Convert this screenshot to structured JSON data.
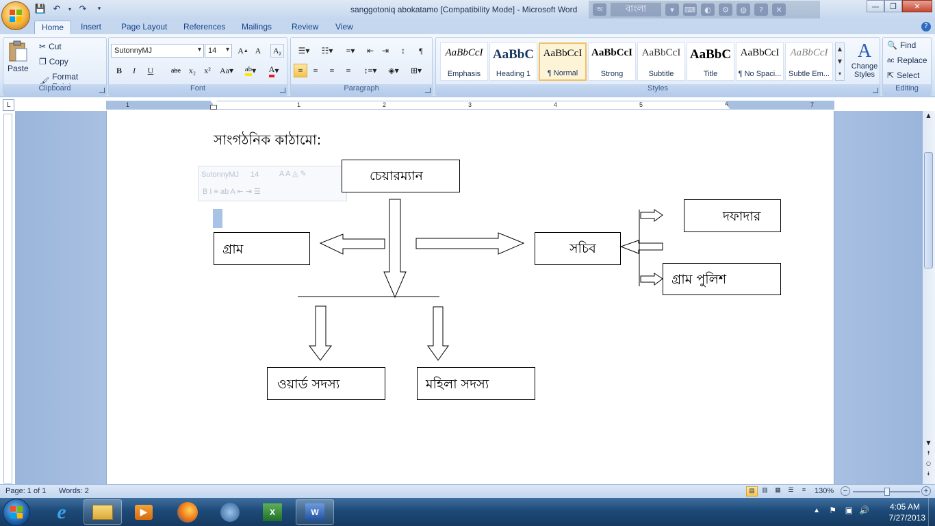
{
  "window": {
    "title": "sanggotoniq abokatamo [Compatibility Mode] - Microsoft Word",
    "controls": {
      "minimize": "—",
      "restore": "❐",
      "close": "✕"
    }
  },
  "ime": {
    "letter": "অ",
    "lang": "বাংলা"
  },
  "tabs": [
    "Home",
    "Insert",
    "Page Layout",
    "References",
    "Mailings",
    "Review",
    "View"
  ],
  "clipboard": {
    "paste": "Paste",
    "cut": "Cut",
    "copy": "Copy",
    "format_painter": "Format Painter",
    "label": "Clipboard"
  },
  "font": {
    "name": "SutonnyMJ",
    "size": "14",
    "label": "Font"
  },
  "paragraph": {
    "label": "Paragraph"
  },
  "styles": {
    "label": "Styles",
    "items": [
      {
        "sample": "AaBbCcI",
        "name": "Emphasis"
      },
      {
        "sample": "AaBbC",
        "name": "Heading 1"
      },
      {
        "sample": "AaBbCcI",
        "name": "¶ Normal"
      },
      {
        "sample": "AaBbCcI",
        "name": "Strong"
      },
      {
        "sample": "AaBbCcI",
        "name": "Subtitle"
      },
      {
        "sample": "AaBbC",
        "name": "Title"
      },
      {
        "sample": "AaBbCcI",
        "name": "¶ No Spaci..."
      },
      {
        "sample": "AaBbCcI",
        "name": "Subtle Em..."
      }
    ],
    "change_styles": "Change Styles"
  },
  "editing": {
    "find": "Find",
    "replace": "Replace",
    "select": "Select",
    "label": "Editing"
  },
  "ruler": {
    "numbers": [
      "1",
      "1",
      "2",
      "3",
      "4",
      "5",
      "6",
      "7"
    ],
    "corner": "L"
  },
  "document": {
    "heading": "সাংগঠনিক  কাঠামো:",
    "boxes": {
      "chairman": "চেয়ারম্যান",
      "village": "গ্রাম",
      "secretary": "সচিব",
      "dafadar": "দফাদার",
      "village_police": "গ্রাম  পুলিশ",
      "ward_member": "ওয়ার্ড  সদস্য",
      "female_member": "মহিলা  সদস্য"
    }
  },
  "minitoolbar": {
    "font": "SutonnyMJ",
    "size": "14"
  },
  "status": {
    "page": "Page: 1 of 1",
    "words": "Words: 2",
    "zoom": "130%"
  },
  "taskbar": {
    "time": "4:05 AM",
    "date": "7/27/2013"
  }
}
